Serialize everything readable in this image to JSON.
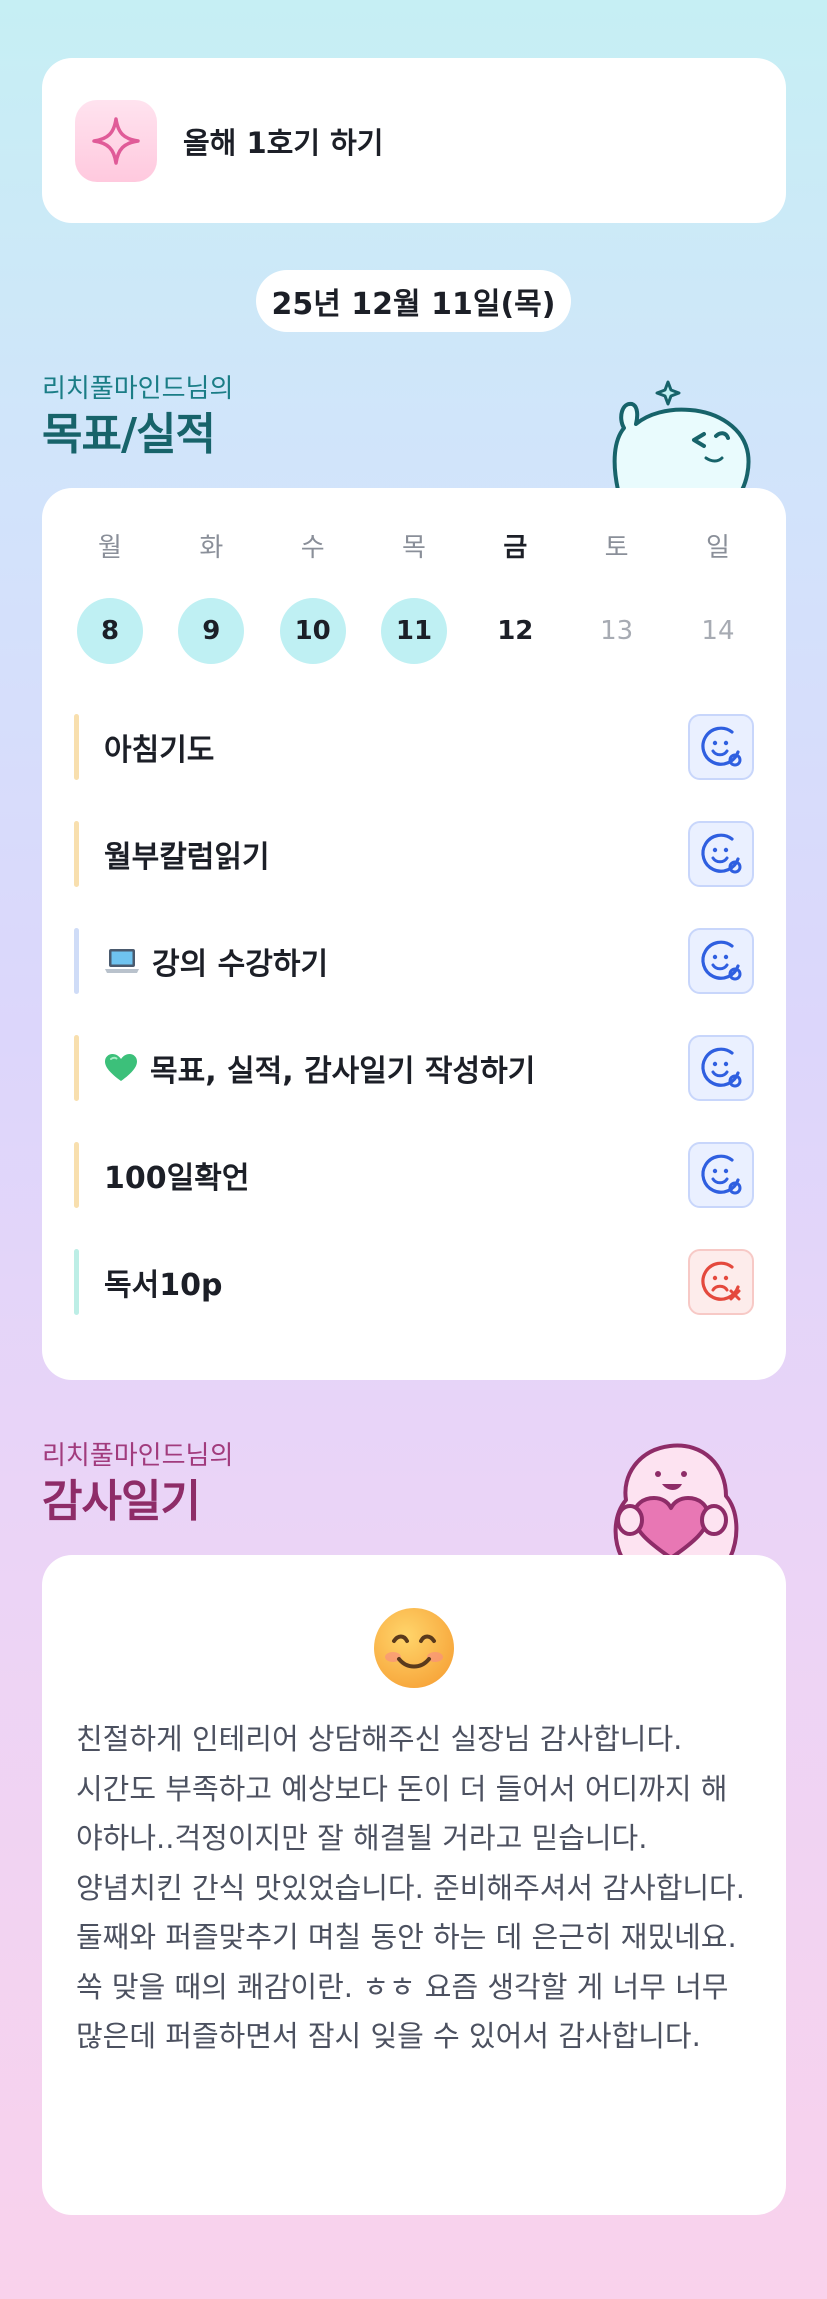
{
  "top_goal": {
    "title": "올해 1호기 하기"
  },
  "date": "25년 12월 11일(목)",
  "goals_section": {
    "subtitle": "리치풀마인드님의",
    "title": "목표/실적"
  },
  "week": [
    {
      "label": "월",
      "num": "8",
      "state": "done"
    },
    {
      "label": "화",
      "num": "9",
      "state": "done"
    },
    {
      "label": "수",
      "num": "10",
      "state": "done"
    },
    {
      "label": "목",
      "num": "11",
      "state": "done"
    },
    {
      "label": "금",
      "num": "12",
      "state": "current"
    },
    {
      "label": "토",
      "num": "13",
      "state": "future"
    },
    {
      "label": "일",
      "num": "14",
      "state": "future"
    }
  ],
  "goals": [
    {
      "text": "아침기도",
      "emoji": "",
      "bar_color": "#f8dfae",
      "status": "achieved"
    },
    {
      "text": "월부칼럼읽기",
      "emoji": "",
      "bar_color": "#f8dfae",
      "status": "achieved"
    },
    {
      "text": "강의 수강하기",
      "emoji": "laptop-icon",
      "bar_color": "#cfdcf7",
      "status": "achieved"
    },
    {
      "text": "목표, 실적, 감사일기 작성하기",
      "emoji": "green-heart-icon",
      "bar_color": "#f8dfae",
      "status": "achieved"
    },
    {
      "text": "100일확언",
      "emoji": "",
      "bar_color": "#f8dfae",
      "status": "achieved"
    },
    {
      "text": "독서10p",
      "emoji": "",
      "bar_color": "#bdeee6",
      "status": "missed"
    }
  ],
  "gratitude_section": {
    "subtitle": "리치풀마인드님의",
    "title": "감사일기"
  },
  "gratitude": {
    "mood_icon": "smiling-face-icon",
    "text": "친절하게 인테리어 상담해주신 실장님 감사합니다.\n시간도 부족하고 예상보다 돈이 더 들어서 어디까지 해야하나..걱정이지만 잘 해결될 거라고 믿습니다.\n양념치킨 간식 맛있었습니다. 준비해주셔서 감사합니다.\n둘째와 퍼즐맞추기 며칠 동안 하는 데 은근히 재밌네요. 쏙 맞을 때의 쾌감이란. ㅎㅎ 요즘 생각할 게 너무 너무 많은데 퍼즐하면서 잠시 잊을 수 있어서 감사합니다."
  },
  "colors": {
    "accent_teal": "#17636a",
    "accent_magenta": "#8e2c68",
    "done_circle": "#bff0f3",
    "status_ok": "#2f5fe0",
    "status_bad": "#e4493d"
  }
}
